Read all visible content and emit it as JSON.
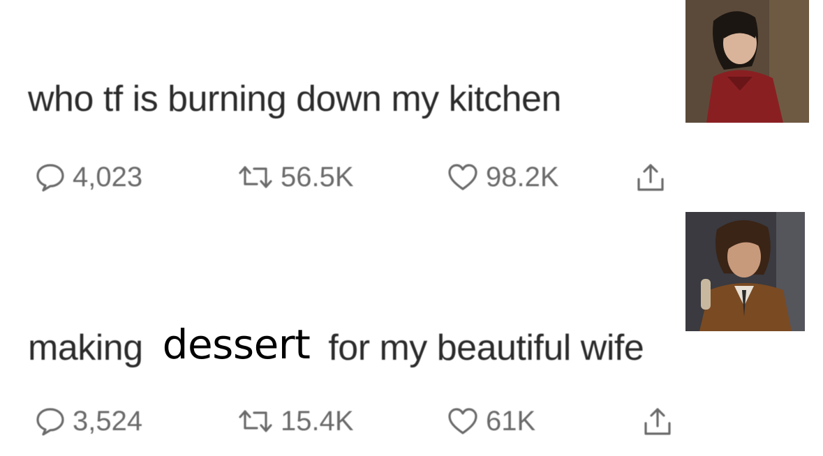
{
  "tweets": [
    {
      "text": "who tf is burning down my kitchen",
      "stats": {
        "replies": "4,023",
        "retweets": "56.5K",
        "likes": "98.2K"
      }
    },
    {
      "text_before": "making",
      "overlay_word": "dessert",
      "text_after": "for my beautiful wife",
      "stats": {
        "replies": "3,524",
        "retweets": "15.4K",
        "likes": "61K"
      }
    }
  ],
  "icons": [
    "reply-icon",
    "retweet-icon",
    "like-icon",
    "share-icon"
  ],
  "colors": {
    "text": "#2b2b2b",
    "icon": "#6a6a6a",
    "overlay_text": "#000000"
  }
}
